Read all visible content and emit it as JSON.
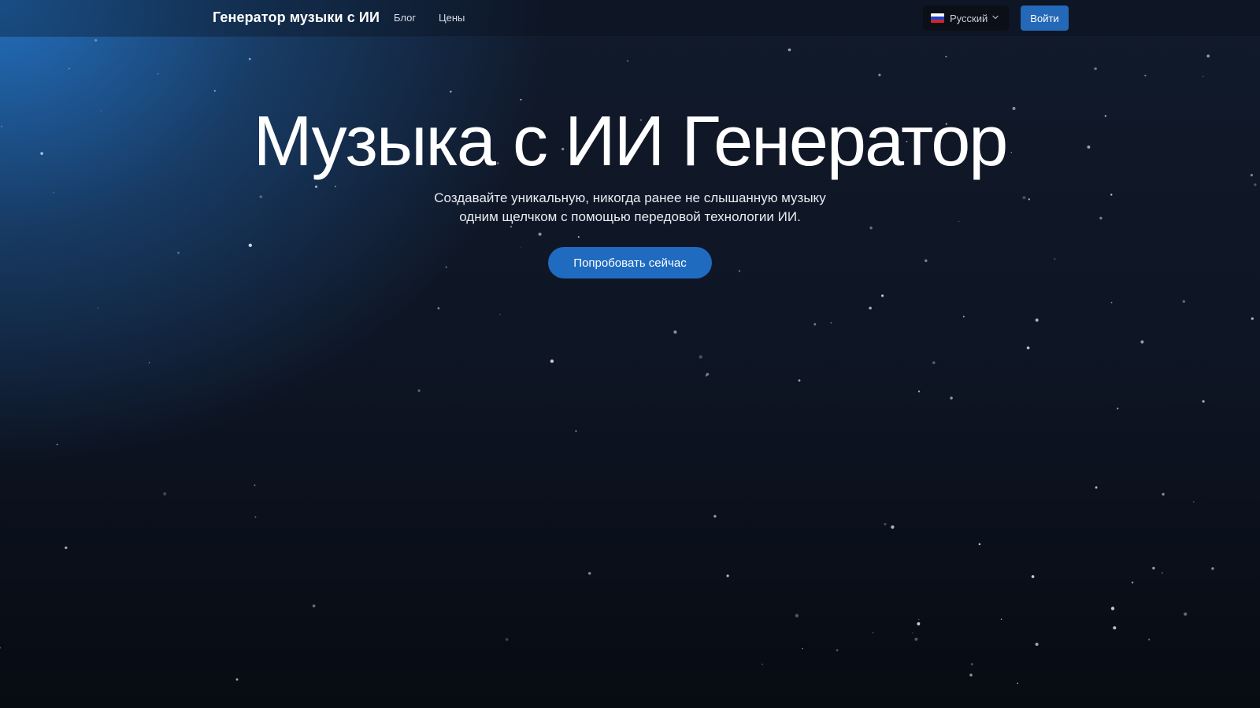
{
  "navbar": {
    "brand": "Генератор музыки с ИИ",
    "links": [
      "Блог",
      "Цены"
    ],
    "language": {
      "selected": "Русский",
      "flag_icon": "russia-flag-icon"
    },
    "login_label": "Войти"
  },
  "hero": {
    "title": "Музыка с ИИ Генератор",
    "subtitle_lines": [
      "Создавайте уникальную, никогда ранее не слышанную музыку",
      "одним щелчком с помощью передовой технологии ИИ."
    ],
    "cta_label": "Попробовать сейчас"
  },
  "colors": {
    "accent": "#2468b8",
    "background": "#0e1524",
    "glow": "#2474c6"
  }
}
